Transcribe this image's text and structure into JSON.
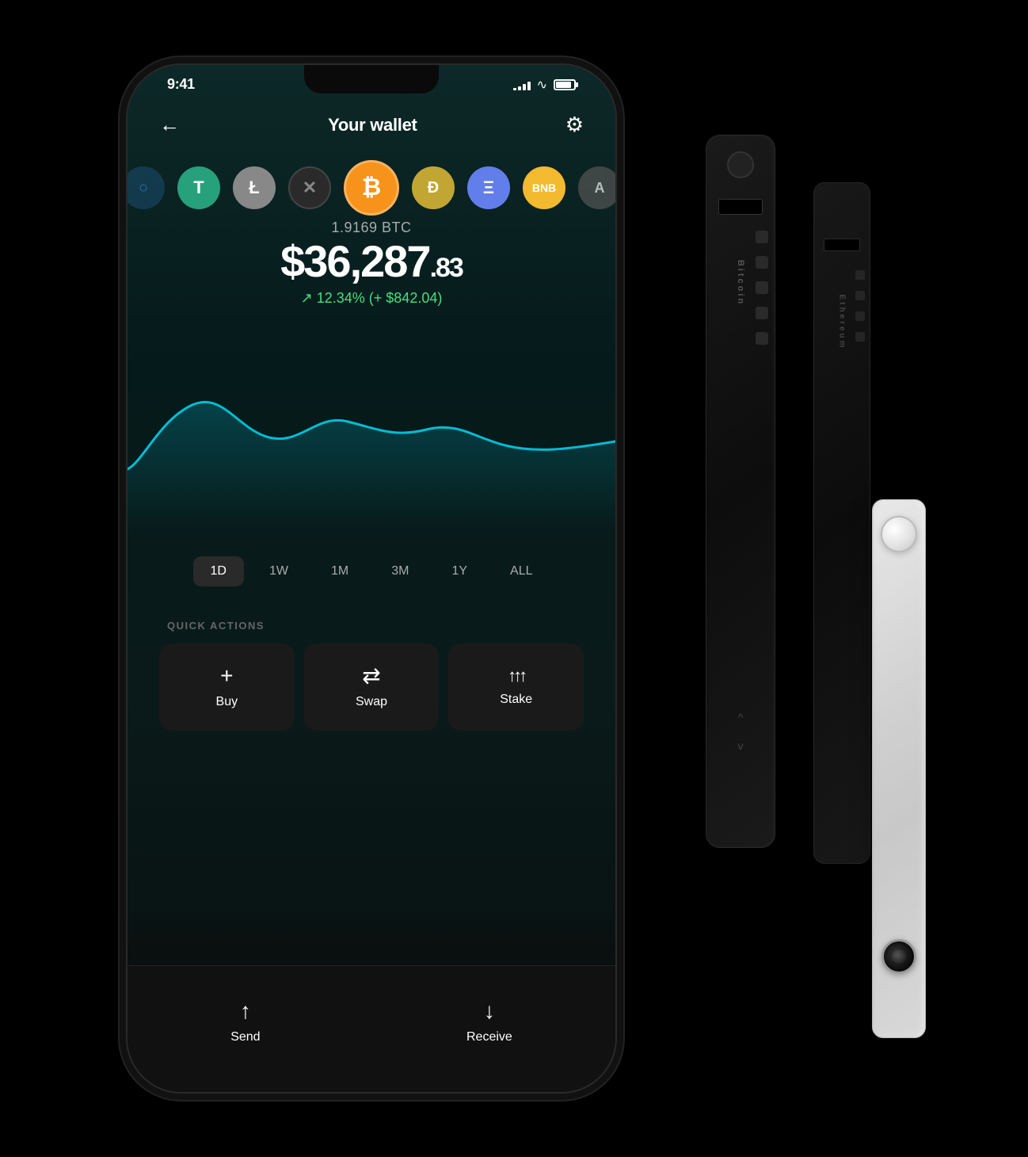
{
  "status": {
    "time": "9:41",
    "signal_bars": [
      3,
      5,
      8,
      11,
      14
    ],
    "battery_percent": 85
  },
  "header": {
    "title": "Your wallet",
    "back_label": "←",
    "settings_label": "⚙"
  },
  "coins": [
    {
      "symbol": "○",
      "color": "#1a6b8a",
      "text_color": "#fff",
      "label": ""
    },
    {
      "symbol": "T",
      "color": "#26a17b",
      "text_color": "#fff",
      "label": "T"
    },
    {
      "symbol": "L",
      "color": "#b5b5b5",
      "text_color": "#fff",
      "label": "Ł"
    },
    {
      "symbol": "✕",
      "color": "#2d2d2d",
      "text_color": "#aaa",
      "label": "×"
    },
    {
      "symbol": "₿",
      "color": "#f7931a",
      "text_color": "#fff",
      "label": "₿"
    },
    {
      "symbol": "D",
      "color": "#c2a633",
      "text_color": "#fff",
      "label": "Ð"
    },
    {
      "symbol": "Ξ",
      "color": "#627eea",
      "text_color": "#fff",
      "label": "Ξ"
    },
    {
      "symbol": "B",
      "color": "#f3ba2f",
      "text_color": "#fff",
      "label": ""
    },
    {
      "symbol": "A",
      "color": "#888",
      "text_color": "#fff",
      "label": "A"
    }
  ],
  "balance": {
    "crypto_amount": "1.9169 BTC",
    "usd_main": "$36,287",
    "usd_cents": ".83",
    "change_text": "↗ 12.34% (+ $842.04)",
    "change_positive": true
  },
  "chart": {
    "color": "#00bcd4",
    "gradient_stop": "rgba(0,188,212,0.15)"
  },
  "time_filters": [
    {
      "label": "1D",
      "active": true
    },
    {
      "label": "1W",
      "active": false
    },
    {
      "label": "1M",
      "active": false
    },
    {
      "label": "3M",
      "active": false
    },
    {
      "label": "1Y",
      "active": false
    },
    {
      "label": "ALL",
      "active": false
    }
  ],
  "quick_actions": {
    "section_label": "QUICK ACTIONS",
    "buttons": [
      {
        "icon": "+",
        "label": "Buy"
      },
      {
        "icon": "⇄",
        "label": "Swap"
      },
      {
        "icon": "↑↑",
        "label": "Stake"
      }
    ]
  },
  "bottom_bar": {
    "buttons": [
      {
        "icon": "↑",
        "label": "Send"
      },
      {
        "icon": "↓",
        "label": "Receive"
      }
    ]
  },
  "devices": {
    "nano_x_text": "Bitcoin",
    "nano_s_text": "Ethereum"
  }
}
